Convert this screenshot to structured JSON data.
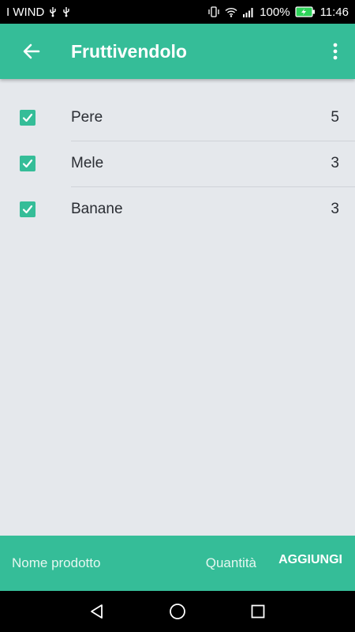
{
  "status_bar": {
    "carrier": "I WIND",
    "battery": "100%",
    "time": "11:46"
  },
  "app_bar": {
    "title": "Fruttivendolo"
  },
  "items": [
    {
      "name": "Pere",
      "quantity": "5",
      "checked": true
    },
    {
      "name": "Mele",
      "quantity": "3",
      "checked": true
    },
    {
      "name": "Banane",
      "quantity": "3",
      "checked": true
    }
  ],
  "bottom_bar": {
    "name_placeholder": "Nome prodotto",
    "quantity_placeholder": "Quantità",
    "add_label": "AGGIUNGI"
  },
  "colors": {
    "accent": "#35bd98",
    "background": "#e5e8ec",
    "text": "#2a2d33"
  },
  "icons": {
    "back": "arrow-left-icon",
    "menu": "more-vertical-icon",
    "check": "check-icon",
    "nav_back": "triangle-back-icon",
    "nav_home": "circle-home-icon",
    "nav_recents": "square-recents-icon"
  }
}
